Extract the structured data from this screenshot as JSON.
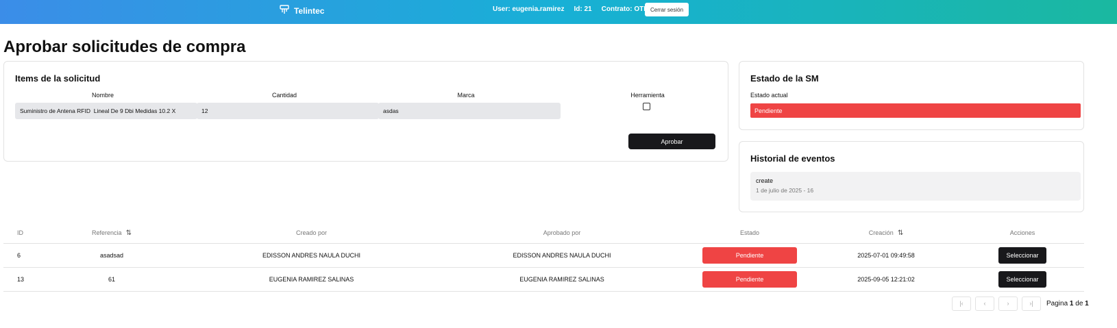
{
  "header": {
    "brand": "Telintec",
    "user": "User: eugenia.ramirez",
    "id": "Id: 21",
    "contract": "Contrato: OTROS",
    "logout_label": "Cerrar sesión"
  },
  "page_title": "Aprobar solicitudes de compra",
  "items": {
    "title": "Items de la solicitud",
    "col_nombre": "Nombre",
    "col_cantidad": "Cantidad",
    "col_marca": "Marca",
    "col_herramienta": "Herramienta",
    "nombre_value": "Suministro de Antena RFID  Lineal De 9 Dbi Medidas 10.2 X",
    "cantidad_value": "12",
    "marca_value": "asdas",
    "herramienta_checked": false,
    "approve_label": "Aprobar"
  },
  "estado": {
    "title": "Estado de la SM",
    "label": "Estado actual",
    "value": "Pendiente",
    "color": "#ef4444"
  },
  "historial": {
    "title": "Historial de eventos",
    "event_name": "create",
    "event_date": "1 de julio de 2025 - 16"
  },
  "table": {
    "headers": {
      "id": "ID",
      "referencia": "Referencia",
      "creado": "Creado por",
      "aprobado": "Aprobado por",
      "estado": "Estado",
      "creacion": "Creación",
      "acciones": "Acciones"
    },
    "rows": [
      {
        "id": "6",
        "referencia": "asadsad",
        "creado": "EDISSON ANDRES NAULA DUCHI",
        "aprobado": "EDISSON ANDRES NAULA DUCHI",
        "estado": "Pendiente",
        "creacion": "2025-07-01 09:49:58",
        "accion": "Seleccionar"
      },
      {
        "id": "13",
        "referencia": "61",
        "creado": "EUGENIA RAMIREZ SALINAS",
        "aprobado": "EUGENIA RAMIREZ SALINAS",
        "estado": "Pendiente",
        "creacion": "2025-09-05 12:21:02",
        "accion": "Seleccionar"
      }
    ]
  },
  "pagination": {
    "prefix": "Pagina",
    "current": "1",
    "of": "de",
    "total": "1"
  }
}
